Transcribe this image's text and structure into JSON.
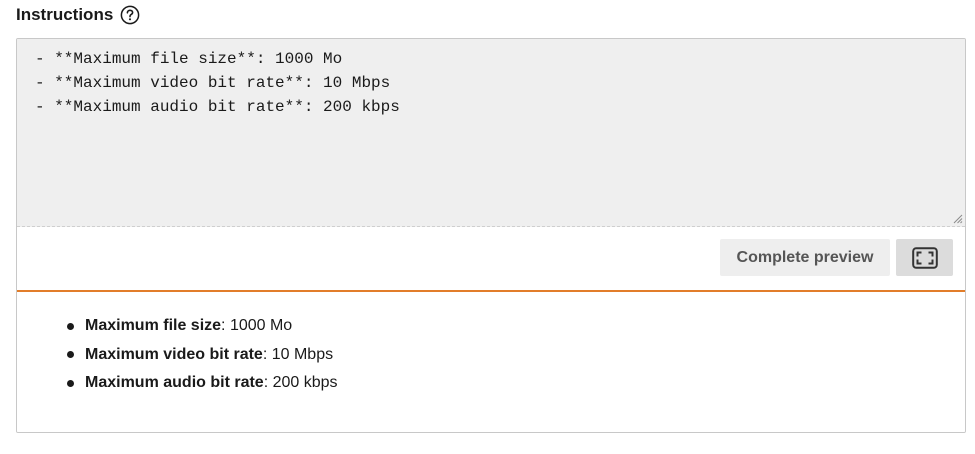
{
  "field": {
    "label": "Instructions",
    "help_icon": "question-circle-icon"
  },
  "editor": {
    "markdown_value": "- **Maximum file size**: 1000 Mo\n- **Maximum video bit rate**: 10 Mbps\n- **Maximum audio bit rate**: 200 kbps"
  },
  "toolbar": {
    "preview_label": "Complete preview",
    "fullscreen_icon": "fullscreen-icon"
  },
  "preview": {
    "items": [
      {
        "label": "Maximum file size",
        "value": ": 1000 Mo"
      },
      {
        "label": "Maximum video bit rate",
        "value": ": 10 Mbps"
      },
      {
        "label": "Maximum audio bit rate",
        "value": ": 200 kbps"
      }
    ]
  },
  "colors": {
    "accent": "#e27d2a",
    "editor_background": "#efefef",
    "button_background": "#eeeeee"
  }
}
